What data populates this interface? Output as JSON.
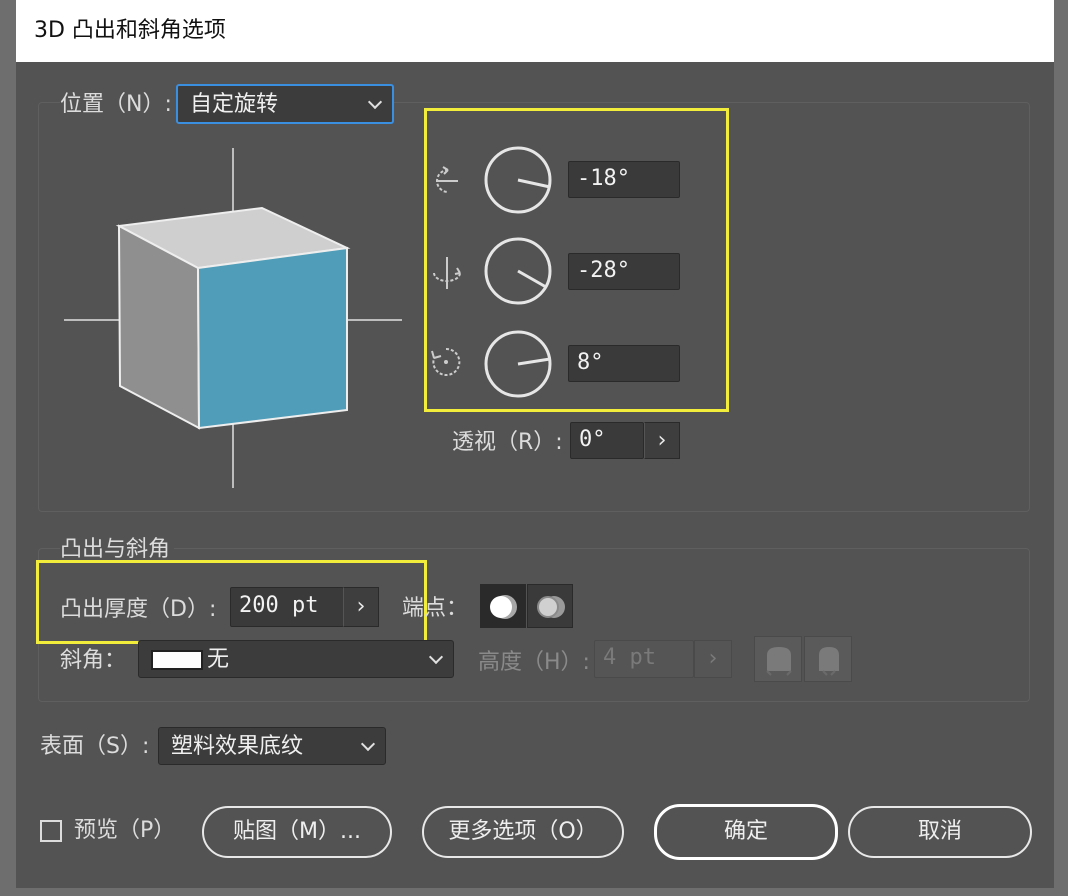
{
  "window": {
    "title": "3D 凸出和斜角选项"
  },
  "position": {
    "label": "位置（N）:",
    "selected": "自定旋转",
    "rotation_x": "-18°",
    "rotation_y": "-28°",
    "rotation_z": "8°",
    "perspective_label": "透视（R）:",
    "perspective_value": "0°"
  },
  "extrude": {
    "section_title": "凸出与斜角",
    "depth_label": "凸出厚度（D）:",
    "depth_value": "200 pt",
    "cap_label": "端点：",
    "bevel_label": "斜角：",
    "bevel_value": "无",
    "height_label": "高度（H）:",
    "height_value": "4 pt"
  },
  "surface": {
    "label": "表面（S）:",
    "selected": "塑料效果底纹"
  },
  "footer": {
    "preview_label": "预览（P）",
    "map_button": "贴图（M）...",
    "more_options_button": "更多选项（O）",
    "ok_button": "确定",
    "cancel_button": "取消"
  },
  "colors": {
    "cube_front": "#4f9db8",
    "highlight": "#f2ec3a",
    "focus": "#3b8fe0"
  }
}
